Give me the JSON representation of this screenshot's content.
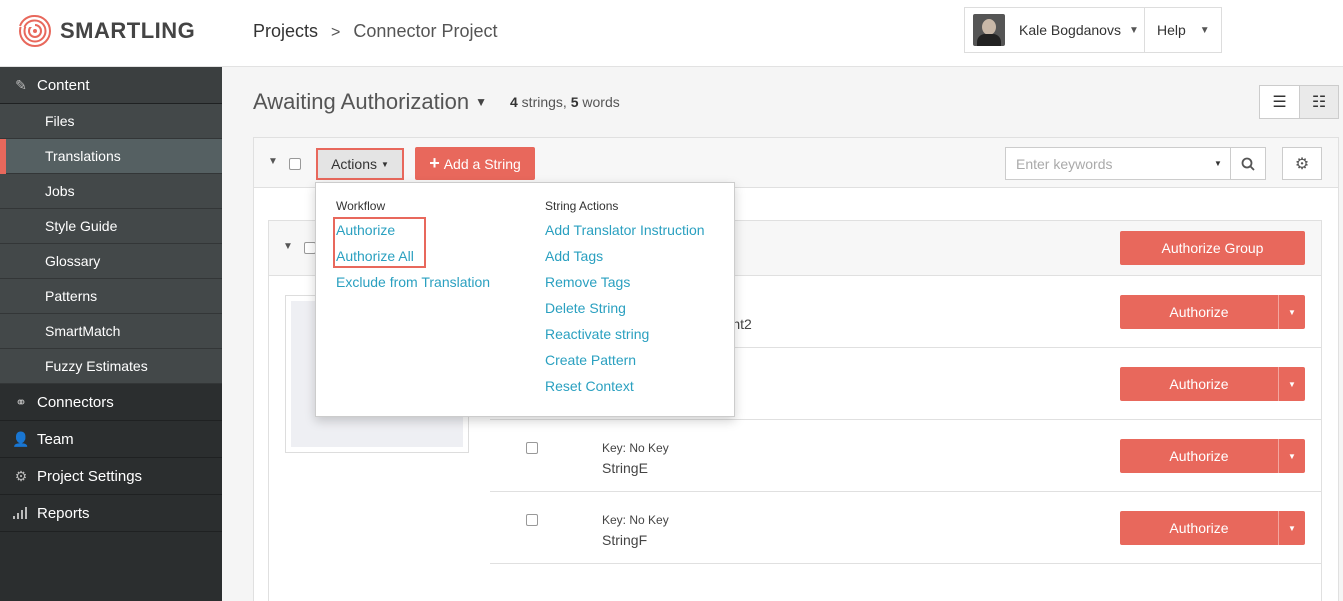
{
  "brand": {
    "name": "SMARTLING",
    "accent": "#e8685c",
    "link_color": "#2aa0c0"
  },
  "header": {
    "breadcrumb_root": "Projects",
    "breadcrumb_sep": ">",
    "breadcrumb_current": "Connector Project",
    "user_name": "Kale Bogdanovs",
    "help_label": "Help"
  },
  "sidebar": {
    "content_label": "Content",
    "items": [
      {
        "label": "Files"
      },
      {
        "label": "Translations",
        "active": true
      },
      {
        "label": "Jobs"
      },
      {
        "label": "Style Guide"
      },
      {
        "label": "Glossary"
      },
      {
        "label": "Patterns"
      },
      {
        "label": "SmartMatch"
      },
      {
        "label": "Fuzzy Estimates"
      }
    ],
    "sections": [
      {
        "label": "Connectors",
        "icon": "connectors-icon"
      },
      {
        "label": "Team",
        "icon": "team-icon"
      },
      {
        "label": "Project Settings",
        "icon": "settings-icon"
      },
      {
        "label": "Reports",
        "icon": "reports-icon"
      }
    ]
  },
  "main": {
    "title": "Awaiting Authorization",
    "count_strings": "4",
    "count_strings_label": " strings, ",
    "count_words": "5",
    "count_words_label": " words"
  },
  "toolbar": {
    "actions_label": "Actions",
    "add_string_label": "Add a String",
    "search_placeholder": "Enter keywords"
  },
  "group": {
    "authorize_group_label": "Authorize Group",
    "partial_text": "ariant2"
  },
  "rows": [
    {
      "key": "",
      "text": "",
      "button": "Authorize"
    },
    {
      "key": "",
      "text": "",
      "button": "Authorize"
    },
    {
      "key": "Key: No Key",
      "text": "StringE",
      "button": "Authorize"
    },
    {
      "key": "Key: No Key",
      "text": "StringF",
      "button": "Authorize"
    }
  ],
  "dropdown": {
    "workflow_heading": "Workflow",
    "workflow_items": [
      "Authorize",
      "Authorize All",
      "Exclude from Translation"
    ],
    "string_actions_heading": "String Actions",
    "string_actions": [
      "Add Translator Instruction",
      "Add Tags",
      "Remove Tags",
      "Delete String",
      "Reactivate string",
      "Create Pattern",
      "Reset Context"
    ]
  }
}
